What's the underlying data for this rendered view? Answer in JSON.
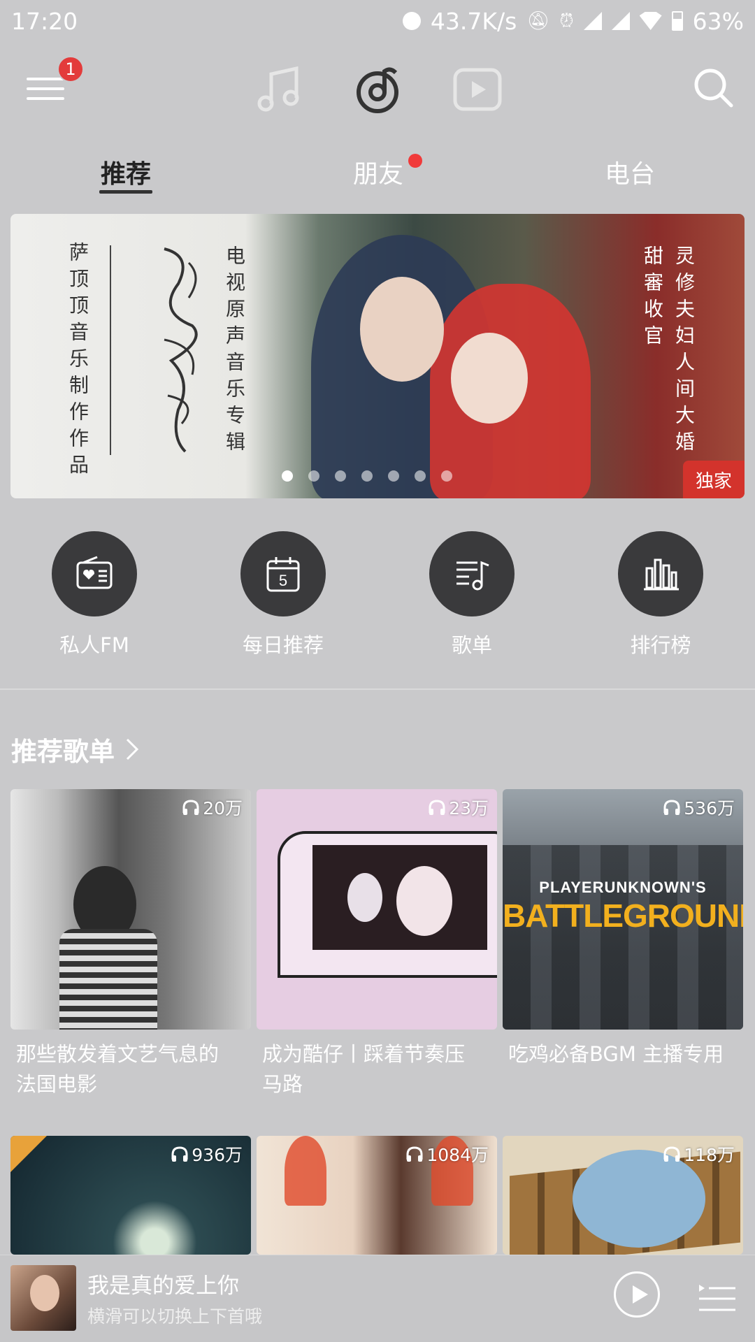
{
  "status_bar": {
    "time": "17:20",
    "net_speed": "43.7K/s",
    "battery": "63%"
  },
  "app_bar": {
    "menu_badge": "1",
    "icons": [
      "menu-icon",
      "music-note-icon",
      "netease-logo-icon",
      "video-icon",
      "search-icon"
    ]
  },
  "tabs": [
    {
      "label": "推荐",
      "active": true
    },
    {
      "label": "朋友",
      "active": false
    },
    {
      "label": "电台",
      "active": false
    }
  ],
  "banner": {
    "left_vertical": "萨顶顶音乐制作作品",
    "right_vertical_1": "电视原声音乐专辑",
    "right_vertical_2": "灵修夫妇人间大婚",
    "right_vertical_3": "甜審收官",
    "tag": "独家",
    "dot_count": 7
  },
  "quick_entries": [
    {
      "label": "私人FM",
      "icon": "radio-icon"
    },
    {
      "label": "每日推荐",
      "icon": "calendar-icon",
      "day": "5"
    },
    {
      "label": "歌单",
      "icon": "playlist-icon"
    },
    {
      "label": "排行榜",
      "icon": "chart-icon"
    }
  ],
  "section": {
    "title": "推荐歌单"
  },
  "playlists": [
    {
      "count": "20万",
      "title_1": "那些散发着文艺气息的",
      "title_2": "法国电影",
      "cover_color": "#8a8a8a"
    },
    {
      "count": "23万",
      "title_1": "成为酷仔丨踩着节奏压",
      "title_2": "马路",
      "cover_color": "#e6cde2"
    },
    {
      "count": "536万",
      "title_1": "吃鸡必备BGM 主播专用",
      "title_2": "",
      "cover_color": "#4a5058"
    },
    {
      "count": "936万",
      "title_1": "",
      "title_2": "",
      "cover_color": "#1e3440"
    },
    {
      "count": "1084万",
      "title_1": "",
      "title_2": "",
      "cover_color": "#e9d6c8"
    },
    {
      "count": "118万",
      "title_1": "",
      "title_2": "",
      "cover_color": "#d8c9ad"
    }
  ],
  "cover_text": {
    "pubg_1": "PLAYERUNKNOWN'S",
    "pubg_2": "BATTLEGROUNDS"
  },
  "mini_player": {
    "title": "我是真的爱上你",
    "subtitle": "横滑可以切换上下首哦"
  }
}
